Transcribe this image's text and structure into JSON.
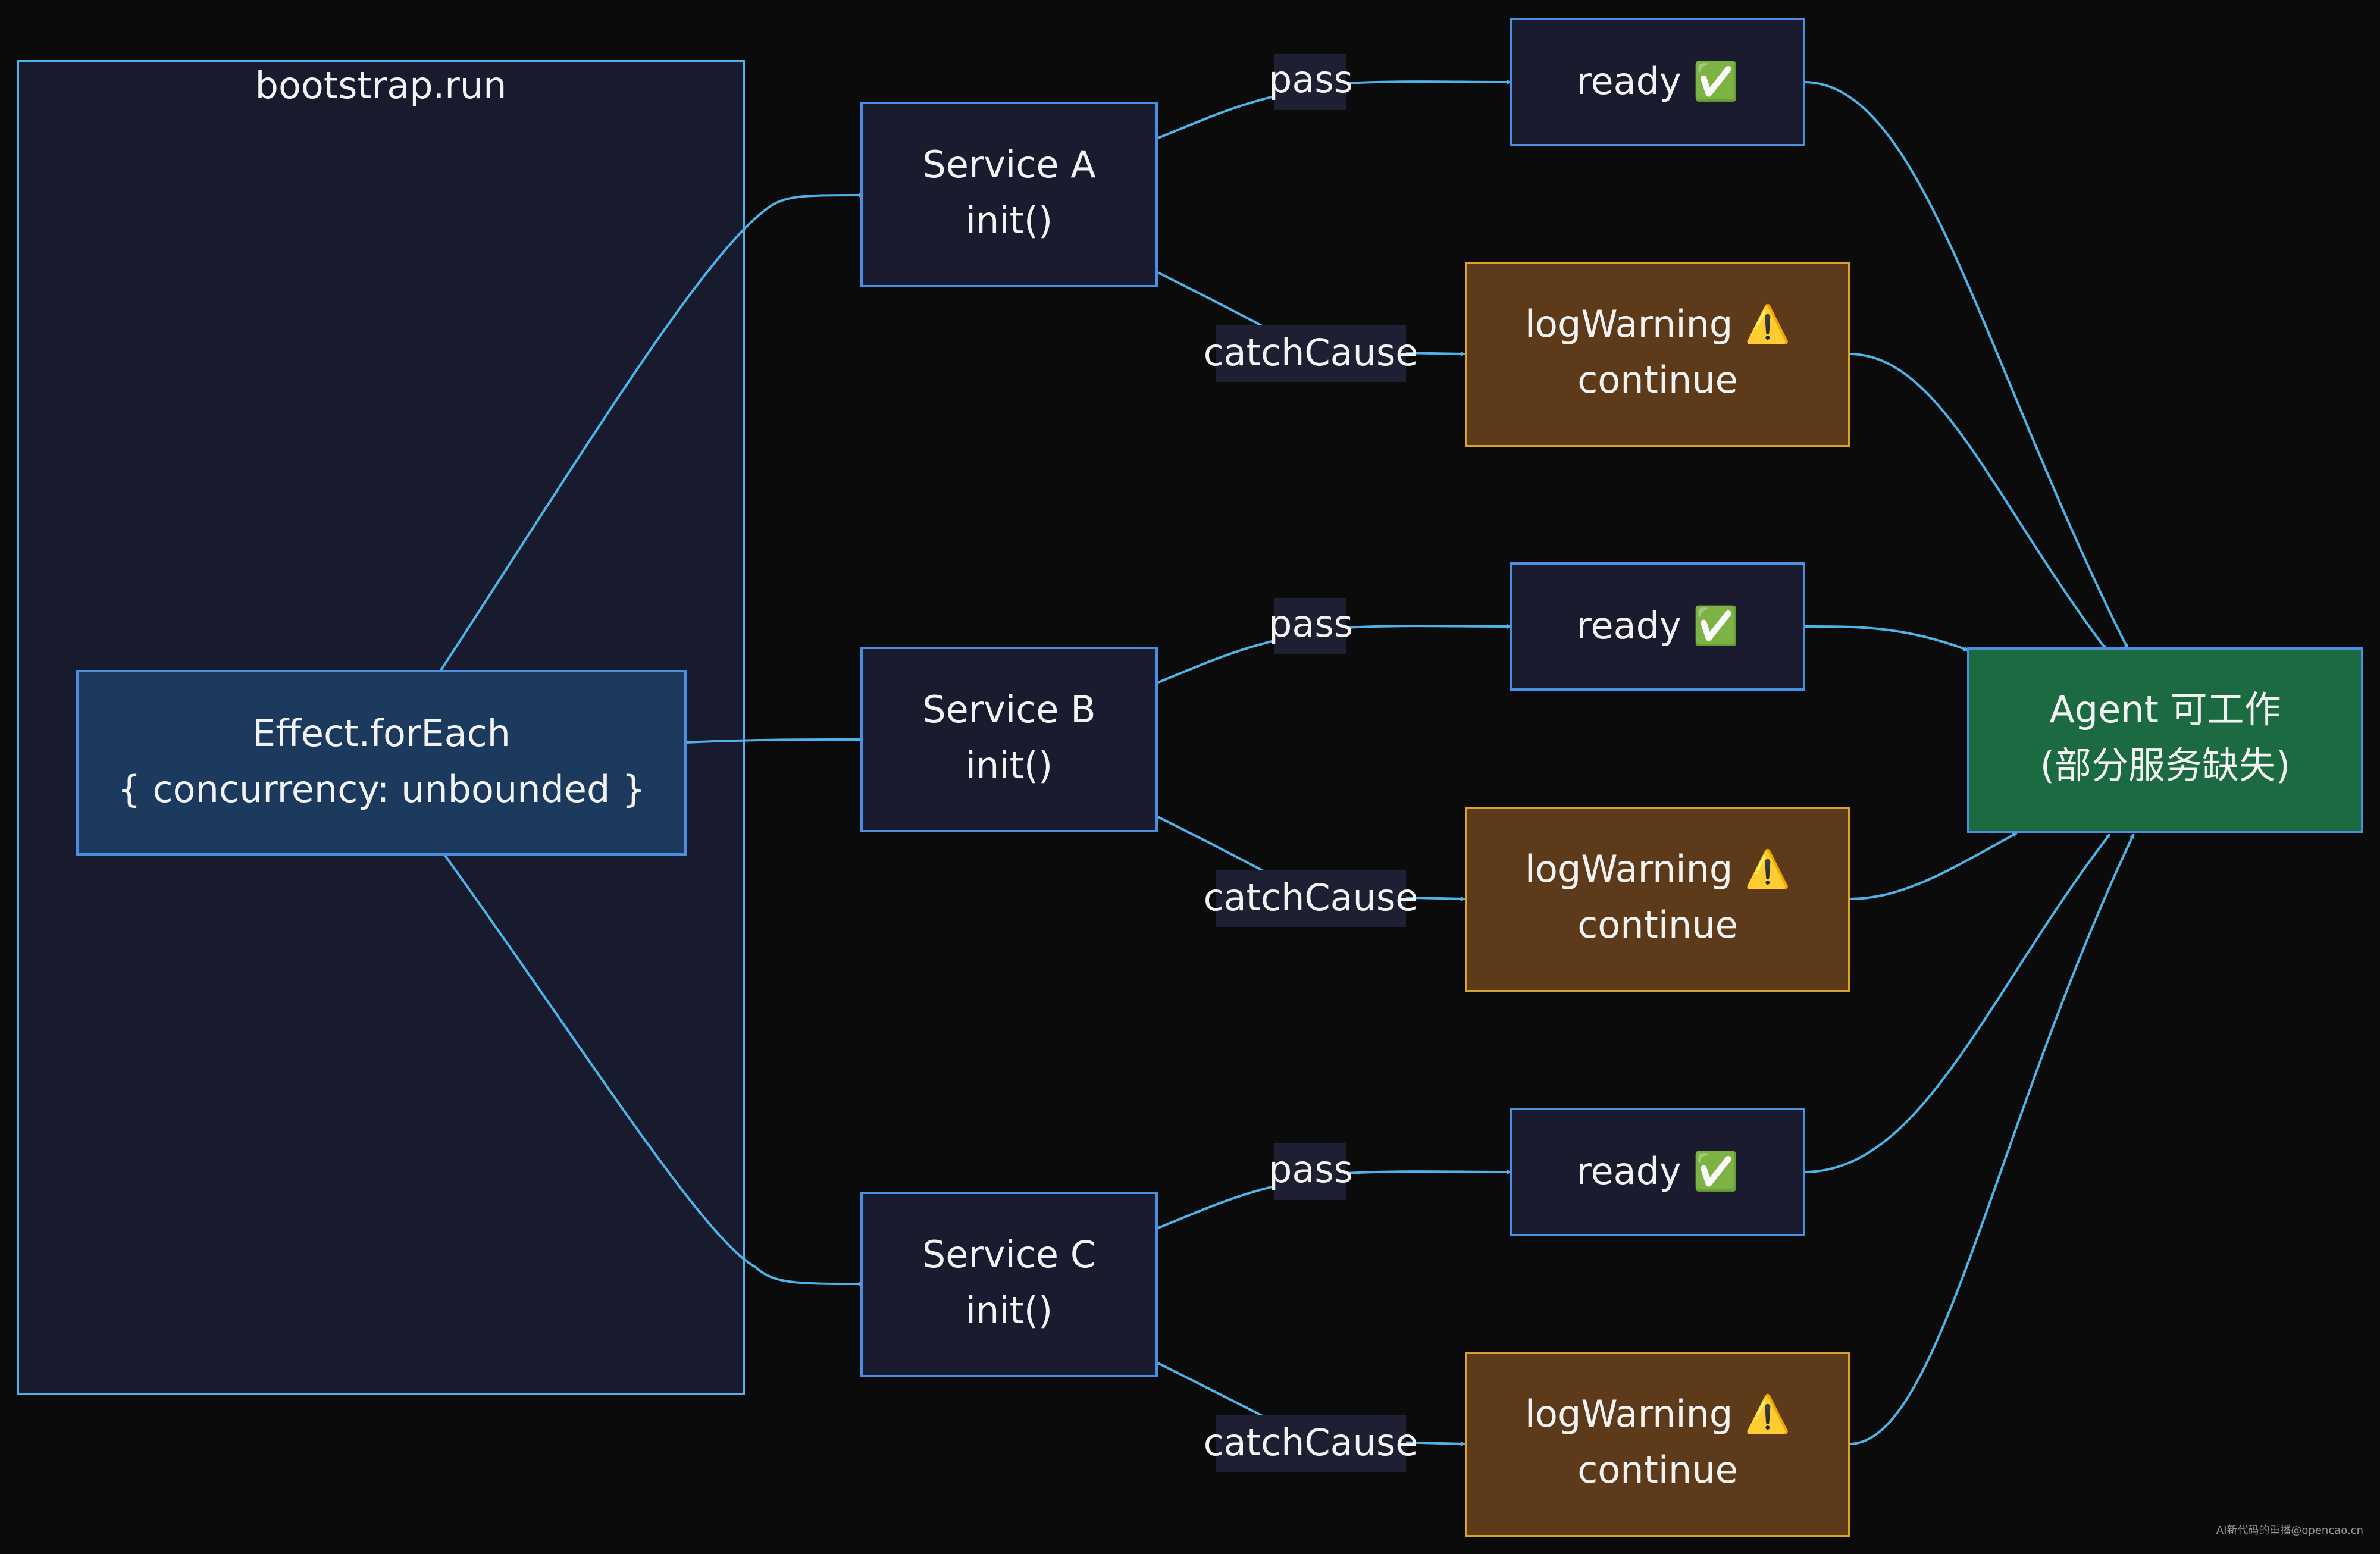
{
  "cluster": {
    "title": "bootstrap.run"
  },
  "effect": {
    "line1": "Effect.forEach",
    "line2": "{ concurrency: unbounded }"
  },
  "services": [
    {
      "line1": "Service A",
      "line2": "init()"
    },
    {
      "line1": "Service B",
      "line2": "init()"
    },
    {
      "line1": "Service C",
      "line2": "init()"
    }
  ],
  "ready": {
    "label": "ready ✅"
  },
  "warning": {
    "line1": "logWarning ⚠️",
    "line2": "continue"
  },
  "edge_labels": {
    "pass": "pass",
    "catch": "catchCause"
  },
  "agent": {
    "line1": "Agent 可工作",
    "line2": "(部分服务缺失)"
  },
  "watermark": "AI新代码的重播@opencao.cn",
  "colors": {
    "background": "#0b0b0b",
    "edge": "#4fb3e8",
    "node_dark": "#1a1b2e",
    "node_blue": "#1b3a5e",
    "node_warn": "#5c3a1a",
    "node_green": "#1b6a42"
  }
}
